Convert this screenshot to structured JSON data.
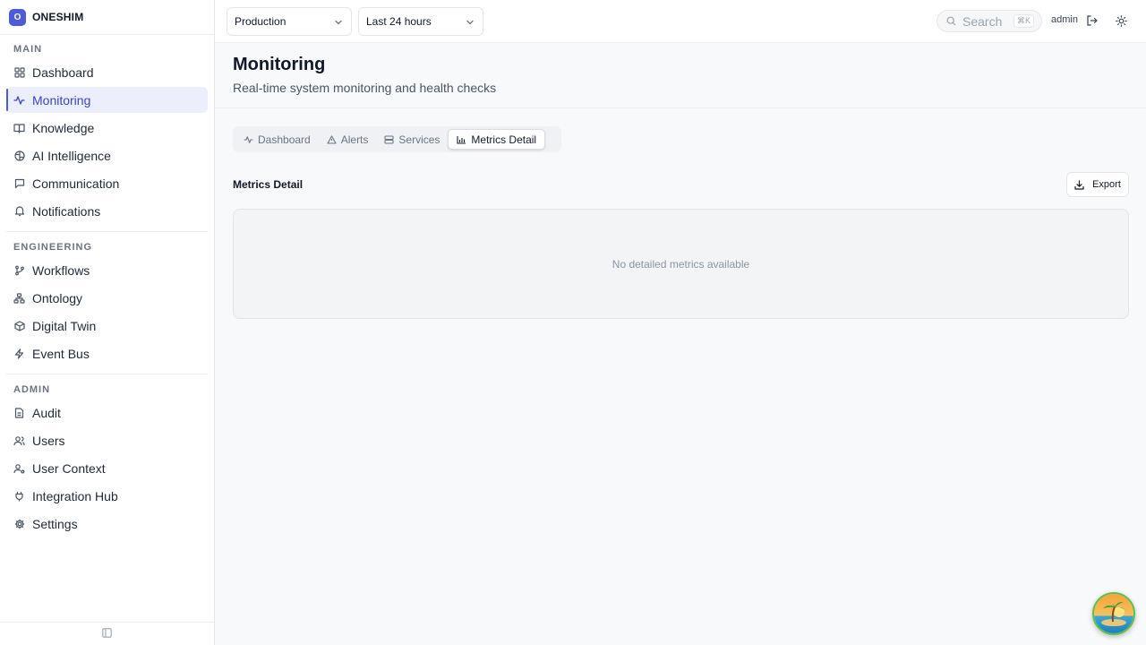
{
  "brand": {
    "logo_letter": "O",
    "name": "ONESHIM",
    "color": "#4f5bd5"
  },
  "sidebar": {
    "sections": [
      {
        "title": "MAIN",
        "items": [
          {
            "label": "Dashboard",
            "icon": "grid-icon"
          },
          {
            "label": "Monitoring",
            "icon": "activity-icon",
            "active": true
          },
          {
            "label": "Knowledge",
            "icon": "book-icon"
          },
          {
            "label": "AI Intelligence",
            "icon": "brain-icon"
          },
          {
            "label": "Communication",
            "icon": "message-icon"
          },
          {
            "label": "Notifications",
            "icon": "bell-icon"
          }
        ]
      },
      {
        "title": "ENGINEERING",
        "items": [
          {
            "label": "Workflows",
            "icon": "git-branch-icon"
          },
          {
            "label": "Ontology",
            "icon": "network-icon"
          },
          {
            "label": "Digital Twin",
            "icon": "cube-icon"
          },
          {
            "label": "Event Bus",
            "icon": "zap-icon"
          }
        ]
      },
      {
        "title": "ADMIN",
        "items": [
          {
            "label": "Audit",
            "icon": "file-text-icon"
          },
          {
            "label": "Users",
            "icon": "users-icon"
          },
          {
            "label": "User Context",
            "icon": "user-context-icon"
          },
          {
            "label": "Integration Hub",
            "icon": "plug-icon"
          },
          {
            "label": "Settings",
            "icon": "gear-icon"
          }
        ]
      }
    ]
  },
  "topbar": {
    "environment_select": "Production",
    "time_range_select": "Last 24 hours",
    "search_placeholder": "Search",
    "search_shortcut": "⌘K",
    "user_name": "admin"
  },
  "header": {
    "title": "Monitoring",
    "subtitle": "Real-time system monitoring and health checks"
  },
  "tabs": [
    {
      "label": "Dashboard",
      "icon": "activity-icon"
    },
    {
      "label": "Alerts",
      "icon": "alert-triangle-icon"
    },
    {
      "label": "Services",
      "icon": "server-icon"
    },
    {
      "label": "Metrics Detail",
      "icon": "bar-chart-icon",
      "active": true
    }
  ],
  "main": {
    "section_title": "Metrics Detail",
    "export_label": "Export",
    "empty_message": "No detailed metrics available"
  },
  "colors": {
    "accent": "#4f5bd5",
    "active_bg": "#eceefc"
  }
}
